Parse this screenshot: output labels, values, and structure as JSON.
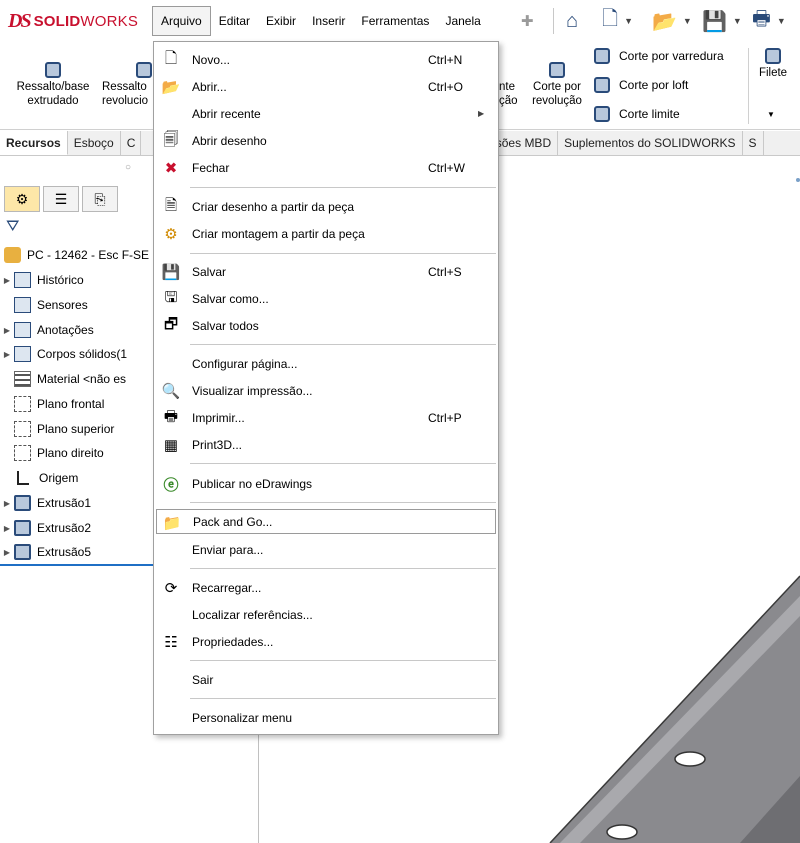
{
  "app": {
    "logo_ds": "DS",
    "logo_solid": "SOLID",
    "logo_works": "WORKS"
  },
  "menubar": [
    "Arquivo",
    "Editar",
    "Exibir",
    "Inserir",
    "Ferramentas",
    "Janela"
  ],
  "quick_access": [
    "home-icon",
    "new-document-icon",
    "open-icon",
    "save-icon",
    "print-icon"
  ],
  "ribbon": {
    "extrude": "Ressalto/base\nextrudado",
    "revolve": "Ressalto\nrevolucio",
    "cut_partial": "nte\nção",
    "cut_revolve": "Corte por\nrevolução",
    "sweep_cut": "Corte por varredura",
    "loft_cut": "Corte por loft",
    "boundary_cut": "Corte limite",
    "fillet": "Filete"
  },
  "tabs": [
    "Recursos",
    "Esboço",
    "C",
    "nensões MBD",
    "Suplementos do SOLIDWORKS",
    "S"
  ],
  "tree": {
    "root": "PC - 12462 - Esc F-SE",
    "items": [
      {
        "label": "Histórico",
        "icon": "folder-icon",
        "expandable": true
      },
      {
        "label": "Sensores",
        "icon": "sensor-icon",
        "expandable": false
      },
      {
        "label": "Anotações",
        "icon": "annotation-icon",
        "expandable": true
      },
      {
        "label": "Corpos sólidos(1",
        "icon": "solid-bodies-icon",
        "expandable": true
      },
      {
        "label": "Material <não es",
        "icon": "material-icon",
        "expandable": false
      },
      {
        "label": "Plano frontal",
        "icon": "plane-icon",
        "expandable": false
      },
      {
        "label": "Plano superior",
        "icon": "plane-icon",
        "expandable": false
      },
      {
        "label": "Plano direito",
        "icon": "plane-icon",
        "expandable": false
      },
      {
        "label": "Origem",
        "icon": "origin-icon",
        "expandable": false
      },
      {
        "label": "Extrusão1",
        "icon": "extrude-icon",
        "expandable": true
      },
      {
        "label": "Extrusão2",
        "icon": "extrude-icon",
        "expandable": true
      },
      {
        "label": "Extrusão5",
        "icon": "extrude-icon",
        "expandable": true
      }
    ]
  },
  "menu": {
    "items": [
      {
        "label": "Novo...",
        "shortcut": "Ctrl+N",
        "icon": "new-icon"
      },
      {
        "label": "Abrir...",
        "shortcut": "Ctrl+O",
        "icon": "open-icon"
      },
      {
        "label": "Abrir recente",
        "shortcut": "",
        "icon": "",
        "submenu": true
      },
      {
        "label": "Abrir desenho",
        "shortcut": "",
        "icon": "open-drawing-icon"
      },
      {
        "label": "Fechar",
        "shortcut": "Ctrl+W",
        "icon": "close-icon"
      },
      {
        "label": "Criar desenho a partir da peça",
        "shortcut": "",
        "icon": "make-drawing-icon"
      },
      {
        "label": "Criar montagem a partir da peça",
        "shortcut": "",
        "icon": "make-assembly-icon"
      },
      {
        "label": "Salvar",
        "shortcut": "Ctrl+S",
        "icon": "save-icon"
      },
      {
        "label": "Salvar como...",
        "shortcut": "",
        "icon": "save-as-icon"
      },
      {
        "label": "Salvar todos",
        "shortcut": "",
        "icon": "save-all-icon"
      },
      {
        "label": "Configurar página...",
        "shortcut": "",
        "icon": ""
      },
      {
        "label": "Visualizar impressão...",
        "shortcut": "",
        "icon": "print-preview-icon"
      },
      {
        "label": "Imprimir...",
        "shortcut": "Ctrl+P",
        "icon": "print-icon"
      },
      {
        "label": "Print3D...",
        "shortcut": "",
        "icon": "print3d-icon"
      },
      {
        "label": "Publicar no eDrawings",
        "shortcut": "",
        "icon": "edrawings-icon"
      },
      {
        "label": "Pack and Go...",
        "shortcut": "",
        "icon": "pack-and-go-icon",
        "highlighted": true
      },
      {
        "label": "Enviar para...",
        "shortcut": "",
        "icon": ""
      },
      {
        "label": "Recarregar...",
        "shortcut": "",
        "icon": "reload-icon"
      },
      {
        "label": "Localizar referências...",
        "shortcut": "",
        "icon": ""
      },
      {
        "label": "Propriedades...",
        "shortcut": "",
        "icon": "properties-icon"
      },
      {
        "label": "Sair",
        "shortcut": "",
        "icon": ""
      },
      {
        "label": "Personalizar menu",
        "shortcut": "",
        "icon": ""
      }
    ]
  }
}
